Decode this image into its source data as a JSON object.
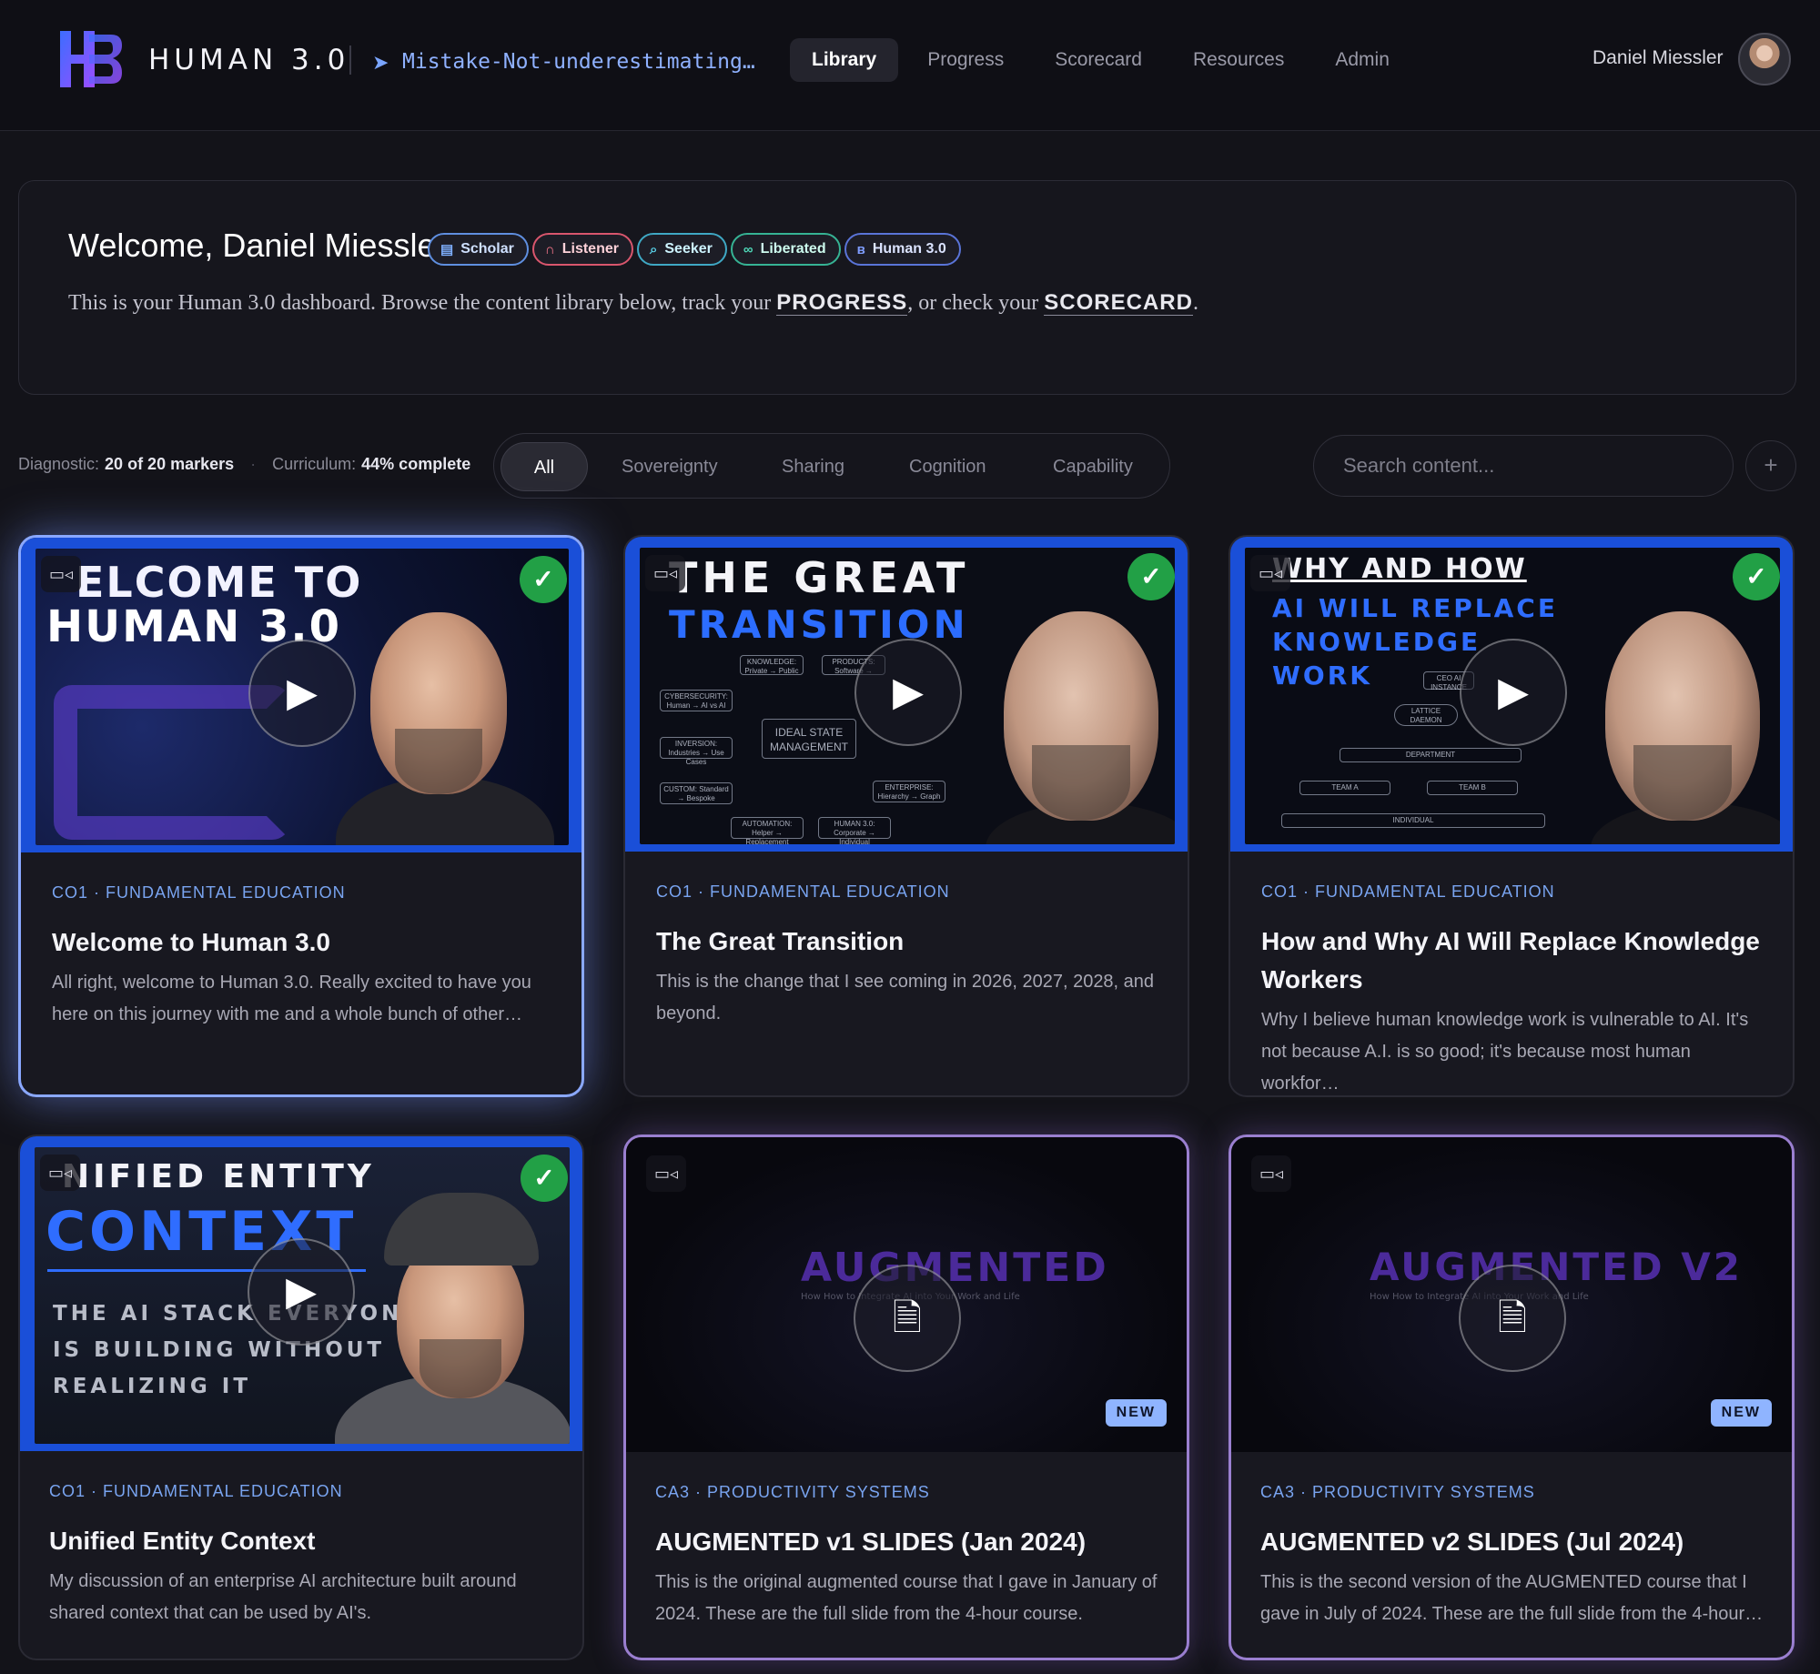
{
  "app": {
    "brand": "HUMAN 3.0",
    "motto": "Mistake-Not-underestimating…"
  },
  "nav": {
    "items": [
      "Library",
      "Progress",
      "Scorecard",
      "Resources",
      "Admin"
    ],
    "active": "Library"
  },
  "user": {
    "name": "Daniel Miessler"
  },
  "welcome": {
    "title": "Welcome, Daniel Miessler.",
    "badges": [
      {
        "label": "Scholar",
        "icon": "book-icon",
        "color": "#7fb0ff"
      },
      {
        "label": "Listener",
        "icon": "headphones-icon",
        "color": "#ff7a8f"
      },
      {
        "label": "Seeker",
        "icon": "search-icon",
        "color": "#59d0e8"
      },
      {
        "label": "Liberated",
        "icon": "link-icon",
        "color": "#4fd8b8"
      },
      {
        "label": "Human 3.0",
        "icon": "h3-logo-icon",
        "color": "#7f9dff"
      }
    ],
    "text_before": "This is your Human 3.0 dashboard. Browse the content library below, track your ",
    "link_progress": "PROGRESS",
    "text_middle": ", or check your ",
    "link_scorecard": "SCORECARD",
    "text_after": "."
  },
  "stats": {
    "diagnostic_label": "Diagnostic:",
    "diagnostic_value": "20 of 20 markers",
    "curriculum_label": "Curriculum:",
    "curriculum_value": "44% complete"
  },
  "filters": {
    "tabs": [
      "All",
      "Sovereignty",
      "Sharing",
      "Cognition",
      "Capability"
    ],
    "active": "All"
  },
  "search": {
    "placeholder": "Search content..."
  },
  "colors": {
    "accent": "#8aa8ff",
    "complete": "#22a046",
    "new_badge": "#8fb4ff",
    "background": "#131319"
  },
  "cards": [
    {
      "thumb_lines": [
        "ELCOME TO",
        "HUMAN 3.0"
      ],
      "meta": "CO1 · FUNDAMENTAL EDUCATION",
      "title": "Welcome to Human 3.0",
      "desc": "All right, welcome to Human 3.0. Really excited to have you here on this journey with me and a whole bunch of other…",
      "completed": true,
      "new": false,
      "type": "video"
    },
    {
      "thumb_lines": [
        "THE GREAT",
        "TRANSITION"
      ],
      "diagram": [
        "KNOWLEDGE: Private → Public",
        "PRODUCTS: Software →",
        "CYBERSECURITY: Human → AI vs AI",
        "IDEAL STATE MANAGEMENT",
        "INVERSION: Industries → Use Cases",
        "CUSTOM: Standard → Bespoke",
        "ENTERPRISE: Hierarchy → Graph",
        "AUTOMATION: Helper → Replacement",
        "HUMAN 3.0: Corporate → Individual"
      ],
      "meta": "CO1 · FUNDAMENTAL EDUCATION",
      "title": "The Great Transition",
      "desc": "This is the change that I see coming in 2026, 2027, 2028, and beyond.",
      "completed": true,
      "new": false,
      "type": "video"
    },
    {
      "thumb_lines": [
        "WHY AND HOW",
        "AI WILL REPLACE",
        "KNOWLEDGE",
        "WORK"
      ],
      "diagram": [
        "CEO AI INSTANCE",
        "LATTICE DAEMON",
        "DEPARTMENT",
        "TEAM A",
        "TEAM B",
        "INDIVIDUAL"
      ],
      "meta": "CO1 · FUNDAMENTAL EDUCATION",
      "title": "How and Why AI Will Replace Knowledge Workers",
      "desc": "Why I believe human knowledge work is vulnerable to AI. It's not because A.I. is so good; it's because most human workfor…",
      "completed": true,
      "new": false,
      "type": "video"
    },
    {
      "thumb_lines": [
        "NIFIED ENTITY",
        "CONTEXT",
        "THE AI STACK EVERYONE",
        "IS BUILDING WITHOUT",
        "REALIZING IT"
      ],
      "meta": "CO1 · FUNDAMENTAL EDUCATION",
      "title": "Unified Entity Context",
      "desc": "My discussion of an enterprise AI architecture built around shared context that can be used by AI's.",
      "completed": true,
      "new": false,
      "type": "video"
    },
    {
      "thumb_lines": [
        "AUGMENTED",
        "How How to Integrate AI into Your Work and Life"
      ],
      "meta": "CA3 · PRODUCTIVITY SYSTEMS",
      "title": "AUGMENTED v1 SLIDES (Jan 2024)",
      "desc": "This is the original augmented course that I gave in January of 2024. These are the full slide from the 4-hour course.",
      "completed": false,
      "new": true,
      "new_label": "NEW",
      "type": "document"
    },
    {
      "thumb_lines": [
        "AUGMENTED V2",
        "How How to Integrate AI into Your Work and Life"
      ],
      "meta": "CA3 · PRODUCTIVITY SYSTEMS",
      "title": "AUGMENTED v2 SLIDES (Jul 2024)",
      "desc": "This is the second version of the AUGMENTED course that I gave in July of 2024. These are the full slide from the 4-hour…",
      "completed": false,
      "new": true,
      "new_label": "NEW",
      "type": "document"
    }
  ]
}
